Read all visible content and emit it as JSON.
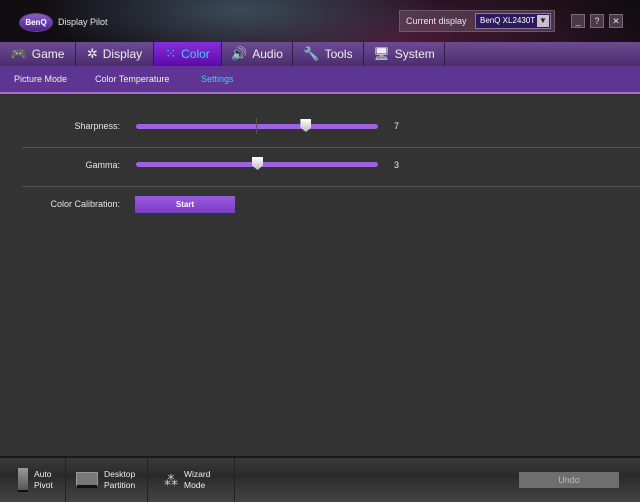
{
  "app": {
    "brand": "BenQ",
    "title": "Display Pilot"
  },
  "current_display": {
    "label": "Current display",
    "value": "BenQ XL2430T"
  },
  "window_buttons": {
    "minimize": "_",
    "help": "?",
    "close": "✕"
  },
  "tabs": [
    {
      "label": "Game",
      "icon": "gamepad-icon",
      "glyph": "🎮"
    },
    {
      "label": "Display",
      "icon": "display-icon",
      "glyph": "✲"
    },
    {
      "label": "Color",
      "icon": "color-dots-icon",
      "glyph": "⁙",
      "active": true
    },
    {
      "label": "Audio",
      "icon": "speaker-icon",
      "glyph": "🔊"
    },
    {
      "label": "Tools",
      "icon": "wrench-icon",
      "glyph": "🔧"
    },
    {
      "label": "System",
      "icon": "computer-icon",
      "glyph": "🖥"
    }
  ],
  "subtabs": [
    {
      "label": "Picture Mode"
    },
    {
      "label": "Color Temperature"
    },
    {
      "label": "Settings",
      "active": true
    }
  ],
  "settings": {
    "sharpness": {
      "label": "Sharpness:",
      "value": "7",
      "min": 1,
      "max": 10
    },
    "gamma": {
      "label": "Gamma:",
      "value": "3",
      "min": 1,
      "max": 5
    },
    "calibration": {
      "label": "Color Calibration:",
      "button": "Start"
    }
  },
  "bottom_bar": {
    "auto_pivot": {
      "line1": "Auto",
      "line2": "Pivot"
    },
    "desktop_partition": {
      "line1": "Desktop",
      "line2": "Partition"
    },
    "wizard_mode": {
      "line1": "Wizard",
      "line2": "Mode"
    },
    "undo": "Undo"
  },
  "colors": {
    "accent": "#a060e0",
    "active_text": "#3ad0ff",
    "tab_bg": "#5e3592"
  }
}
